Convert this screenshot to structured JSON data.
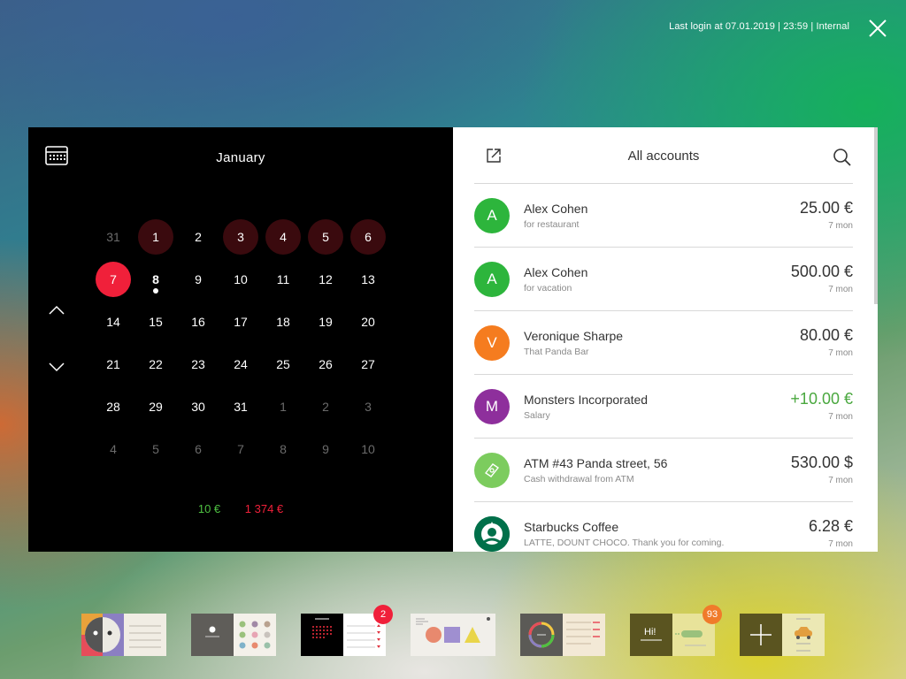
{
  "header": {
    "last_login": "Last login at 07.01.2019 | 23:59 | Internal",
    "close_icon": "close-icon"
  },
  "calendar": {
    "month": "January",
    "icon": "calendar-icon",
    "weeks": [
      [
        {
          "d": "31",
          "type": "other"
        },
        {
          "d": "1",
          "type": "event"
        },
        {
          "d": "2",
          "type": "normal"
        },
        {
          "d": "3",
          "type": "event"
        },
        {
          "d": "4",
          "type": "event"
        },
        {
          "d": "5",
          "type": "event"
        },
        {
          "d": "6",
          "type": "event"
        }
      ],
      [
        {
          "d": "7",
          "type": "selected"
        },
        {
          "d": "8",
          "type": "today"
        },
        {
          "d": "9",
          "type": "normal"
        },
        {
          "d": "10",
          "type": "normal"
        },
        {
          "d": "11",
          "type": "normal"
        },
        {
          "d": "12",
          "type": "normal"
        },
        {
          "d": "13",
          "type": "normal"
        }
      ],
      [
        {
          "d": "14",
          "type": "normal"
        },
        {
          "d": "15",
          "type": "normal"
        },
        {
          "d": "16",
          "type": "normal"
        },
        {
          "d": "17",
          "type": "normal"
        },
        {
          "d": "18",
          "type": "normal"
        },
        {
          "d": "19",
          "type": "normal"
        },
        {
          "d": "20",
          "type": "normal"
        }
      ],
      [
        {
          "d": "21",
          "type": "normal"
        },
        {
          "d": "22",
          "type": "normal"
        },
        {
          "d": "23",
          "type": "normal"
        },
        {
          "d": "24",
          "type": "normal"
        },
        {
          "d": "25",
          "type": "normal"
        },
        {
          "d": "26",
          "type": "normal"
        },
        {
          "d": "27",
          "type": "normal"
        }
      ],
      [
        {
          "d": "28",
          "type": "normal"
        },
        {
          "d": "29",
          "type": "normal"
        },
        {
          "d": "30",
          "type": "normal"
        },
        {
          "d": "31",
          "type": "normal"
        },
        {
          "d": "1",
          "type": "other"
        },
        {
          "d": "2",
          "type": "other"
        },
        {
          "d": "3",
          "type": "other"
        }
      ],
      [
        {
          "d": "4",
          "type": "other"
        },
        {
          "d": "5",
          "type": "other"
        },
        {
          "d": "6",
          "type": "other"
        },
        {
          "d": "7",
          "type": "other"
        },
        {
          "d": "8",
          "type": "other"
        },
        {
          "d": "9",
          "type": "other"
        },
        {
          "d": "10",
          "type": "other"
        }
      ]
    ],
    "income_total": "10 €",
    "expense_total": "1 374 €",
    "colors": {
      "selected": "#f0203a",
      "event": "#3a0a0e",
      "income": "#4ec142",
      "expense": "#f0203a"
    }
  },
  "transactions": {
    "title": "All accounts",
    "export_icon": "export-icon",
    "search_icon": "search-icon",
    "items": [
      {
        "initial": "A",
        "color": "#2db53c",
        "name": "Alex Cohen",
        "sub": "for restaurant",
        "amount": "25.00 €",
        "time": "7 mon",
        "positive": false
      },
      {
        "initial": "A",
        "color": "#2db53c",
        "name": "Alex Cohen",
        "sub": "for vacation",
        "amount": "500.00 €",
        "time": "7 mon",
        "positive": false
      },
      {
        "initial": "V",
        "color": "#f57c1f",
        "name": "Veronique Sharpe",
        "sub": "That Panda Bar",
        "amount": "80.00 €",
        "time": "7 mon",
        "positive": false
      },
      {
        "initial": "M",
        "color": "#8e2f9c",
        "name": "Monsters Incorporated",
        "sub": "Salary",
        "amount": "+10.00 €",
        "time": "7 mon",
        "positive": true
      },
      {
        "initial": "",
        "icon": "cash-icon",
        "color": "#7ccc5e",
        "name": "ATM #43 Panda street, 56",
        "sub": "Cash withdrawal from ATM",
        "amount": "530.00 $",
        "time": "7 mon",
        "positive": false
      },
      {
        "initial": "",
        "icon": "starbucks-logo",
        "color": "#00704a",
        "name": "Starbucks Coffee",
        "sub": "LATTE, DOUNT CHOCO. Thank you for coming.",
        "amount": "6.28 €",
        "time": "7 mon",
        "positive": false
      }
    ]
  },
  "dock": {
    "apps": [
      {
        "name": "app-thumb-contacts",
        "badge": ""
      },
      {
        "name": "app-thumb-settings",
        "badge": ""
      },
      {
        "name": "app-thumb-calendar",
        "badge": "2",
        "badge_color": "#f0203a"
      },
      {
        "name": "app-thumb-shapes",
        "badge": ""
      },
      {
        "name": "app-thumb-stats",
        "badge": ""
      },
      {
        "name": "app-thumb-chat",
        "badge": "93",
        "badge_color": "#f07b2a",
        "chat_text": "Hi!"
      },
      {
        "name": "app-thumb-add",
        "badge": ""
      }
    ]
  }
}
